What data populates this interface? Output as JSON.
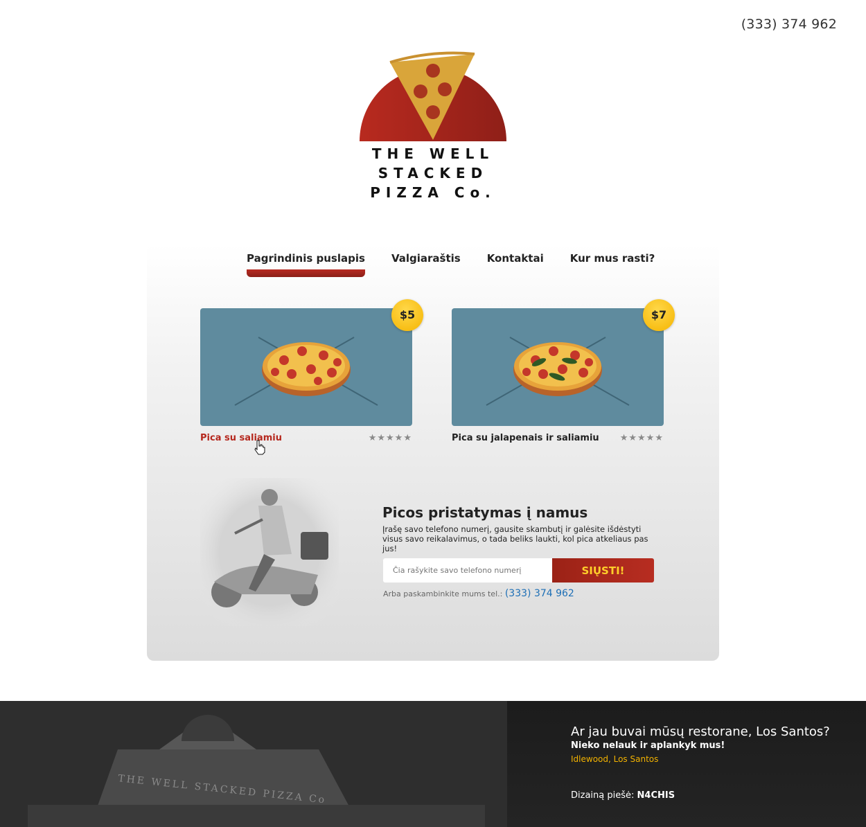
{
  "header": {
    "phone": "(333) 374 962"
  },
  "logo": {
    "line1": "THE WELL",
    "line2": "STACKED",
    "line3": "PIZZA Co."
  },
  "nav": [
    {
      "label": "Pagrindinis puslapis",
      "active": true
    },
    {
      "label": "Valgiaraštis",
      "active": false
    },
    {
      "label": "Kontaktai",
      "active": false
    },
    {
      "label": "Kur mus rasti?",
      "active": false
    }
  ],
  "products": [
    {
      "name": "Pica su saliamiu",
      "price": "$5",
      "stars": "★★★★★",
      "rating": 5
    },
    {
      "name": "Pica su jalapenais ir saliamiu",
      "price": "$7",
      "stars": "★★★★★",
      "rating": 5
    }
  ],
  "delivery": {
    "title": "Picos pristatymas į namus",
    "text": "Įrašę savo telefono numerį, gausite skambutį ir galėsite išdėstyti visus savo reikalavimus, o tada beliks laukti, kol pica atkeliaus pas jus!",
    "input_placeholder": "Čia rašykite savo telefono numerį",
    "submit_label": "SIŲSTI!",
    "call_prefix": "Arba paskambinkite mums tel.:",
    "call_phone": "(333) 374 962"
  },
  "footer": {
    "title": "Ar jau buvai mūsų restorane, Los Santos?",
    "subtitle": "Nieko nelauk ir aplankyk mus!",
    "location": "Idlewood, Los Santos",
    "credit_prefix": "Dizainą piešė:",
    "credit_author": "N4CHIS",
    "photo_sign": "THE WELL STACKED PIZZA Co"
  },
  "colors": {
    "accent_red": "#b5281e",
    "accent_yellow": "#f5b400",
    "link_blue": "#1d6fb6"
  }
}
